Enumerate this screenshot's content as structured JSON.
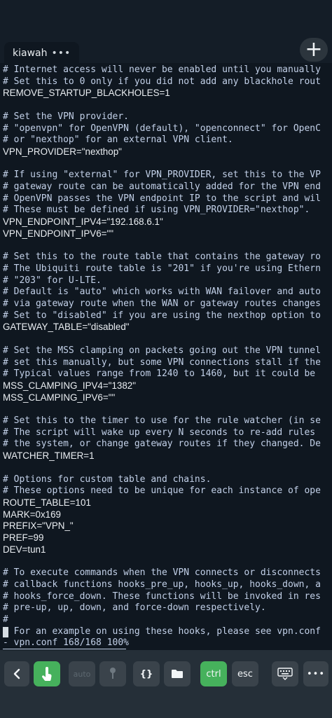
{
  "tab": {
    "title": "kiawah",
    "menu": "•••"
  },
  "add_tab": "+",
  "lines": [
    "# Internet access will never be enabled until you manually",
    "# Set this to 0 only if you did not add any blackhole rout",
    "REMOVE_STARTUP_BLACKHOLES=1",
    "",
    "# Set the VPN provider.",
    "# \"openvpn\" for OpenVPN (default), \"openconnect\" for OpenC",
    "# or \"nexthop\" for an external VPN client.",
    "VPN_PROVIDER=\"nexthop\"",
    "",
    "# If using \"external\" for VPN_PROVIDER, set this to the VP",
    "# gateway route can be automatically added for the VPN end",
    "# OpenVPN passes the VPN endpoint IP to the script and wil",
    "# These must be defined if using VPN_PROVIDER=\"nexthop\".",
    "VPN_ENDPOINT_IPV4=\"192.168.6.1\"",
    "VPN_ENDPOINT_IPV6=\"\"",
    "",
    "# Set this to the route table that contains the gateway ro",
    "# The Ubiquiti route table is \"201\" if you're using Ethern",
    "# \"203\" for U-LTE.",
    "# Default is \"auto\" which works with WAN failover and auto",
    "# via gateway route when the WAN or gateway routes changes",
    "# Set to \"disabled\" if you are using the nexthop option to",
    "GATEWAY_TABLE=\"disabled\"",
    "",
    "# Set the MSS clamping on packets going out the VPN tunnel",
    "# set this manually, but some VPN connections stall if the",
    "# Typical values range from 1240 to 1460, but it could be",
    "MSS_CLAMPING_IPV4=\"1382\"",
    "MSS_CLAMPING_IPV6=\"\"",
    "",
    "# Set this to the timer to use for the rule watcher (in se",
    "# The script will wake up every N seconds to re-add rules",
    "# the system, or change gateway routes if they changed. De",
    "WATCHER_TIMER=1",
    "",
    "# Options for custom table and chains.",
    "# These options need to be unique for each instance of ope",
    "ROUTE_TABLE=101",
    "MARK=0x169",
    "PREFIX=\"VPN_\"",
    "PREF=99",
    "DEV=tun1",
    "",
    "# To execute commands when the VPN connects or disconnects",
    "# callback functions hooks_pre_up, hooks_up, hooks_down, a",
    "# hooks_force_down. These functions will be invoked in res",
    "# pre-up, up, down, and force-down respectively.",
    "#",
    "# For an example on using these hooks, please see vpn.conf"
  ],
  "status_line": "- vpn.conf 168/168 100%",
  "keys": {
    "back": "back-icon",
    "touch": "touch-icon",
    "auto": "auto",
    "hint": "pin-icon",
    "braces": "{}",
    "folder": "folder-icon",
    "ctrl": "ctrl",
    "esc": "esc",
    "keyboard": "keyboard-icon",
    "more": "•••"
  },
  "colors": {
    "background": "#0f1720",
    "comment": "#c2d0e8",
    "value": "#eaeef2",
    "accent_green": "#46b15c"
  }
}
